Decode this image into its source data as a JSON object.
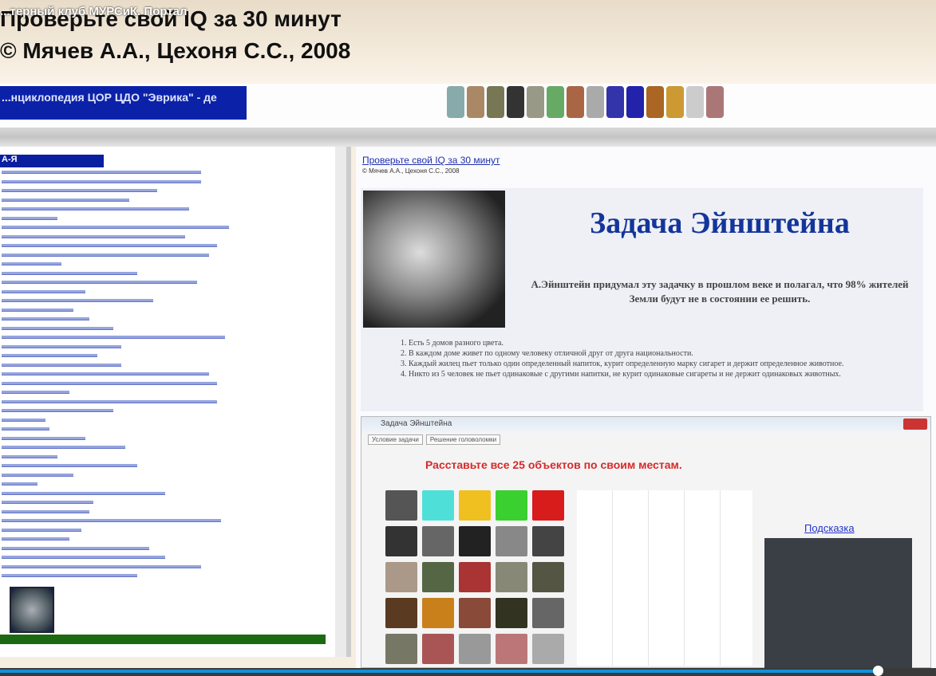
{
  "video": {
    "title": "...терный клуб МУРСиК. Портал",
    "progress_percent": 93.8
  },
  "header": {
    "line1": "Проверьте свой IQ за 30 минут",
    "line2": "© Мячев А.А., Цехоня С.С., 2008"
  },
  "topbar": {
    "encyclopedia_label": "...нциклопедия ЦОР ЦДО \"Эврика\" - де"
  },
  "sidebar": {
    "index_header": "А-Я"
  },
  "main": {
    "link": "Проверьте свой IQ за 30 минут",
    "subtitle": "© Мячев А.А., Цехоня С.С., 2008",
    "puzzle_title": "Задача Эйнштейна",
    "puzzle_description": "А.Эйнштейн придумал эту задачку в прошлом веке и полагал, что 98% жителей Земли будут не в состоянии ее решить.",
    "rules": [
      "Есть 5 домов разного цвета.",
      "В каждом доме живет по одному человеку отличной друг от друга национальности.",
      "Каждый жилец пьет только один определенный напиток, курит определенную марку сигарет и держит определенное животное.",
      "Никто из 5 человек не пьет одинаковые с другими напитки, не курит одинаковые сигареты и не держит одинаковых животных."
    ]
  },
  "app": {
    "window_title": "Задача Эйнштейна",
    "tabs": [
      "Условие задачи",
      "Решение головоломки"
    ],
    "task": "Расставьте все 25 объектов по своим местам.",
    "hint_link": "Подсказка"
  }
}
